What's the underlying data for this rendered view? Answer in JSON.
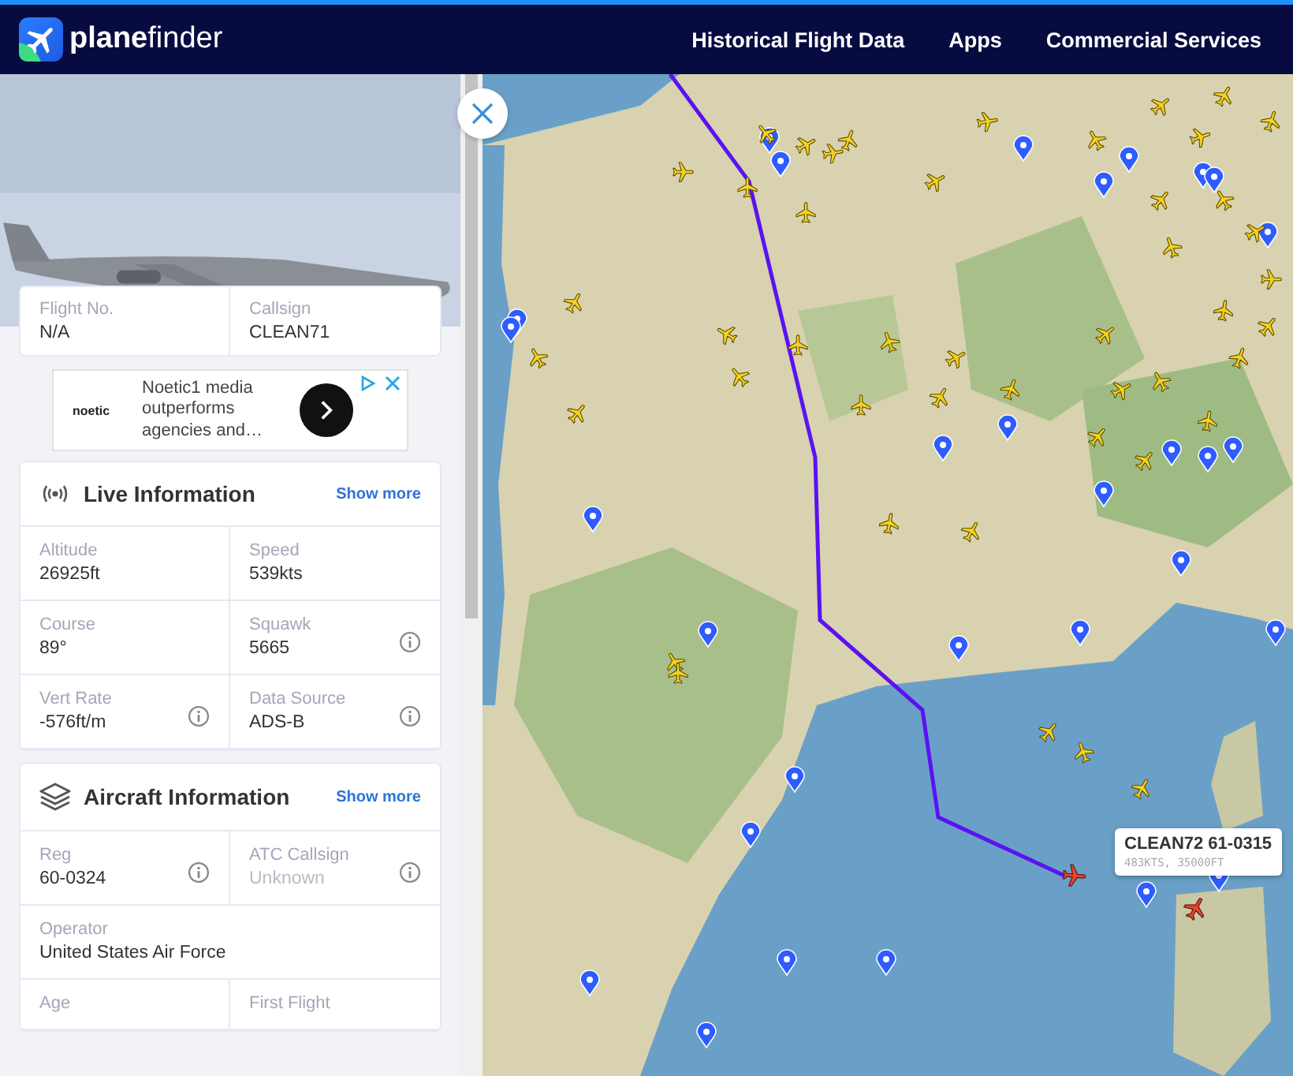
{
  "header": {
    "logo": "**plane**finder",
    "nav": [
      {
        "label": "Historical Flight Data"
      },
      {
        "label": "Apps"
      },
      {
        "label": "Commercial Services"
      }
    ]
  },
  "flight": [
    {
      "label": "Flight No.",
      "value": "N/A"
    },
    {
      "label": "Callsign",
      "value": "CLEAN71"
    }
  ],
  "ad": {
    "brand": "noetic",
    "text": "Noetic1 media outperforms agencies and…"
  },
  "sections": [
    {
      "kind": "live",
      "title": "Live Information",
      "action": "Show more",
      "fields": [
        {
          "label": "Altitude",
          "value": "26925ft",
          "info": false,
          "muted": false,
          "wide": false
        },
        {
          "label": "Speed",
          "value": "539kts",
          "info": false,
          "muted": false,
          "wide": false
        },
        {
          "label": "Course",
          "value": "89°",
          "info": false,
          "muted": false,
          "wide": false
        },
        {
          "label": "Squawk",
          "value": "5665",
          "info": true,
          "muted": false,
          "wide": false
        },
        {
          "label": "Vert Rate",
          "value": "-576ft/m",
          "info": true,
          "muted": false,
          "wide": false
        },
        {
          "label": "Data Source",
          "value": "ADS-B",
          "info": true,
          "muted": false,
          "wide": false
        }
      ]
    },
    {
      "kind": "aircraft",
      "title": "Aircraft Information",
      "action": "Show more",
      "fields": [
        {
          "label": "Reg",
          "value": "60-0324",
          "info": true,
          "muted": false,
          "wide": false
        },
        {
          "label": "ATC Callsign",
          "value": "Unknown",
          "info": true,
          "muted": true,
          "wide": false
        },
        {
          "label": "Operator",
          "value": "United States Air Force",
          "info": false,
          "muted": false,
          "wide": true
        },
        {
          "label": "Age",
          "info": false,
          "wide": false
        },
        {
          "label": "First Flight",
          "info": false,
          "wide": false
        }
      ]
    }
  ],
  "map": {
    "tooltip": {
      "title": "CLEAN72 61-0315",
      "subtitle": "483KTS, 35000FT"
    }
  }
}
